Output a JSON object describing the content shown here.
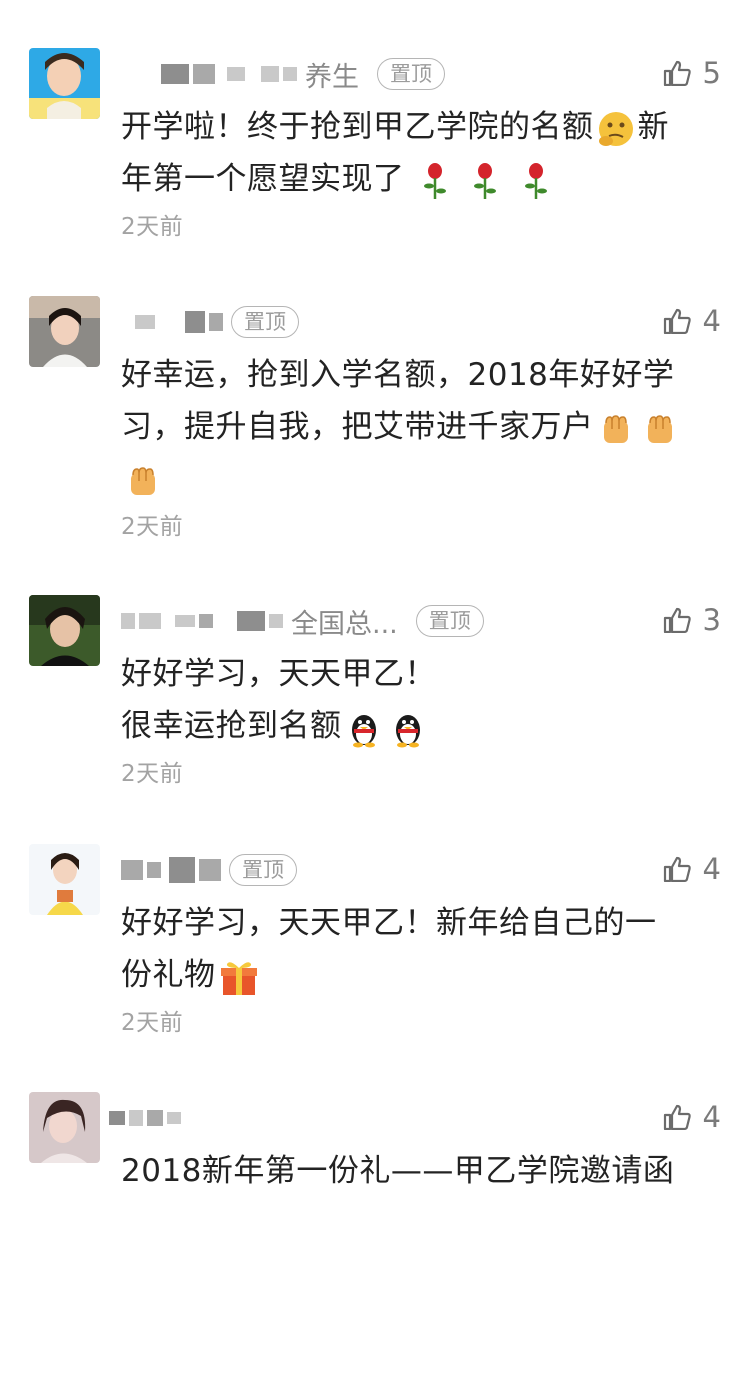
{
  "comments": [
    {
      "name_visible": "养生",
      "pin_label": "置顶",
      "likes": "5",
      "text_lines": [
        "开学啦！终于抢到甲乙学院的名额",
        "新",
        "年第一个愿望实现了"
      ],
      "emojis": [
        "thinking-face",
        "rose",
        "rose",
        "rose"
      ],
      "time": "2天前"
    },
    {
      "name_visible": "",
      "pin_label": "置顶",
      "likes": "4",
      "text_lines": [
        "好幸运，抢到入学名额，2018年好好学",
        "习，提升自我，把艾带进千家万户"
      ],
      "emojis": [
        "raised-fist",
        "raised-fist",
        "raised-fist"
      ],
      "time": "2天前"
    },
    {
      "name_visible": "全国总...",
      "pin_label": "置顶",
      "likes": "3",
      "text_lines": [
        "好好学习，天天甲乙！",
        "很幸运抢到名额"
      ],
      "emojis": [
        "penguin",
        "penguin"
      ],
      "time": "2天前"
    },
    {
      "name_visible": "",
      "pin_label": "置顶",
      "likes": "4",
      "text_lines": [
        "好好学习，天天甲乙！新年给自己的一",
        "份礼物"
      ],
      "emojis": [
        "gift"
      ],
      "time": "2天前"
    },
    {
      "name_visible": "",
      "pin_label": "",
      "likes": "4",
      "text_lines": [
        "2018新年第一份礼——甲乙学院邀请函"
      ],
      "emojis": [],
      "time": ""
    }
  ],
  "colors": {
    "text": "#232323",
    "muted": "#a3a3a3",
    "icon": "#6b6b6b",
    "pin_border": "#b5b5b5"
  },
  "icons": {
    "like": "thumbs-up-icon"
  }
}
